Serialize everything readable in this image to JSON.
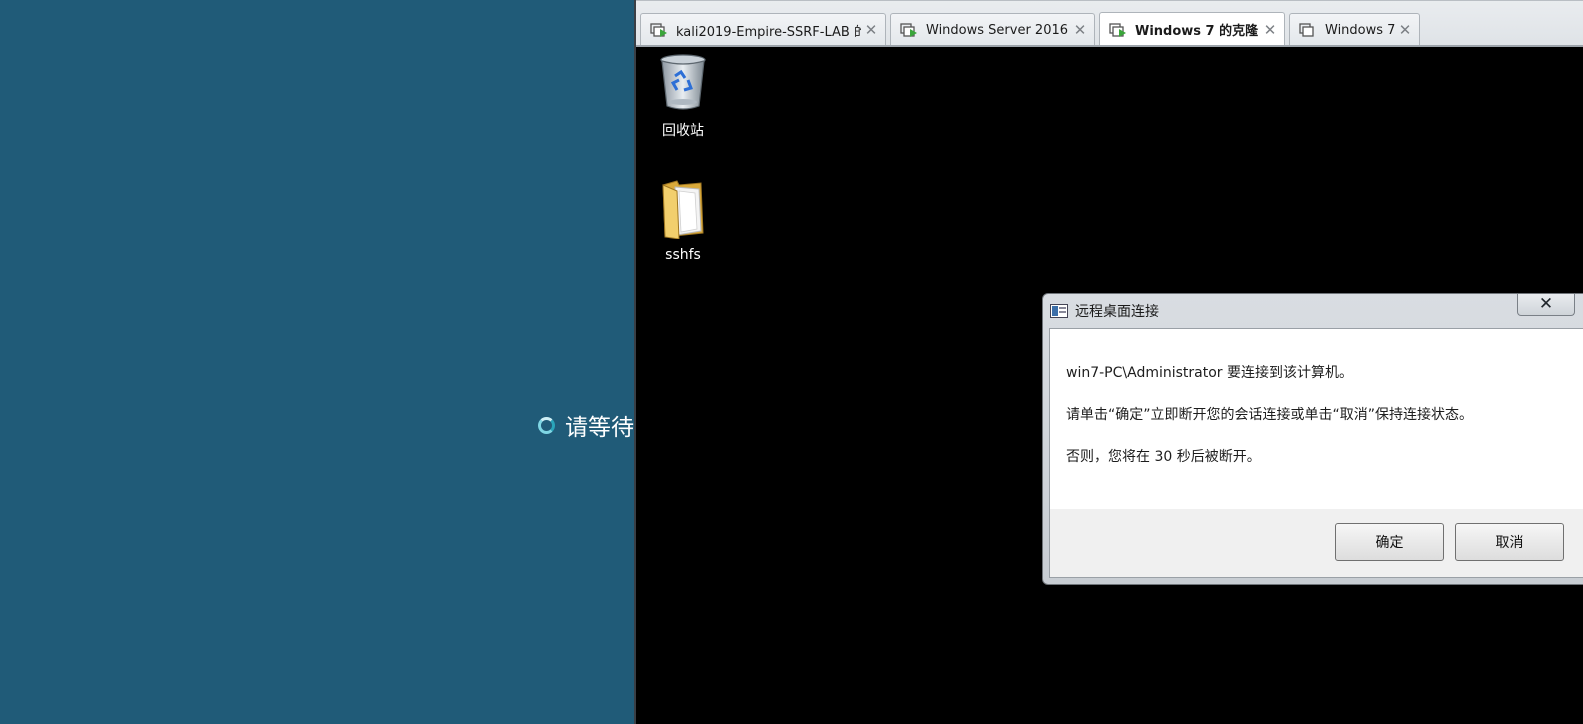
{
  "left_pane": {
    "wait_text": "请等待"
  },
  "tabs": [
    {
      "label": "kali2019-Empire-SSRF-LAB 的...",
      "close": "✕",
      "running": true
    },
    {
      "label": "Windows Server 2016",
      "close": "✕",
      "running": true
    },
    {
      "label": "Windows 7 的克隆",
      "close": "✕",
      "running": true,
      "active": true
    },
    {
      "label": "Windows 7",
      "close": "✕",
      "running": false
    }
  ],
  "desktop": {
    "icons": [
      {
        "label": "回收站",
        "icon": "recycle-bin-icon"
      },
      {
        "label": "sshfs",
        "icon": "folder-icon"
      }
    ]
  },
  "dialog": {
    "title": "远程桌面连接",
    "close": "✕",
    "line1": "win7-PC\\Administrator 要连接到该计算机。",
    "line2": "请单击“确定”立即断开您的会话连接或单击“取消”保持连接状态。",
    "line3": "否则，您将在 30 秒后被断开。",
    "ok_label": "确定",
    "cancel_label": "取消"
  },
  "colors": {
    "left_background": "#205b78",
    "vm_background": "#000000",
    "vm_running_green": "#3aa53a"
  }
}
